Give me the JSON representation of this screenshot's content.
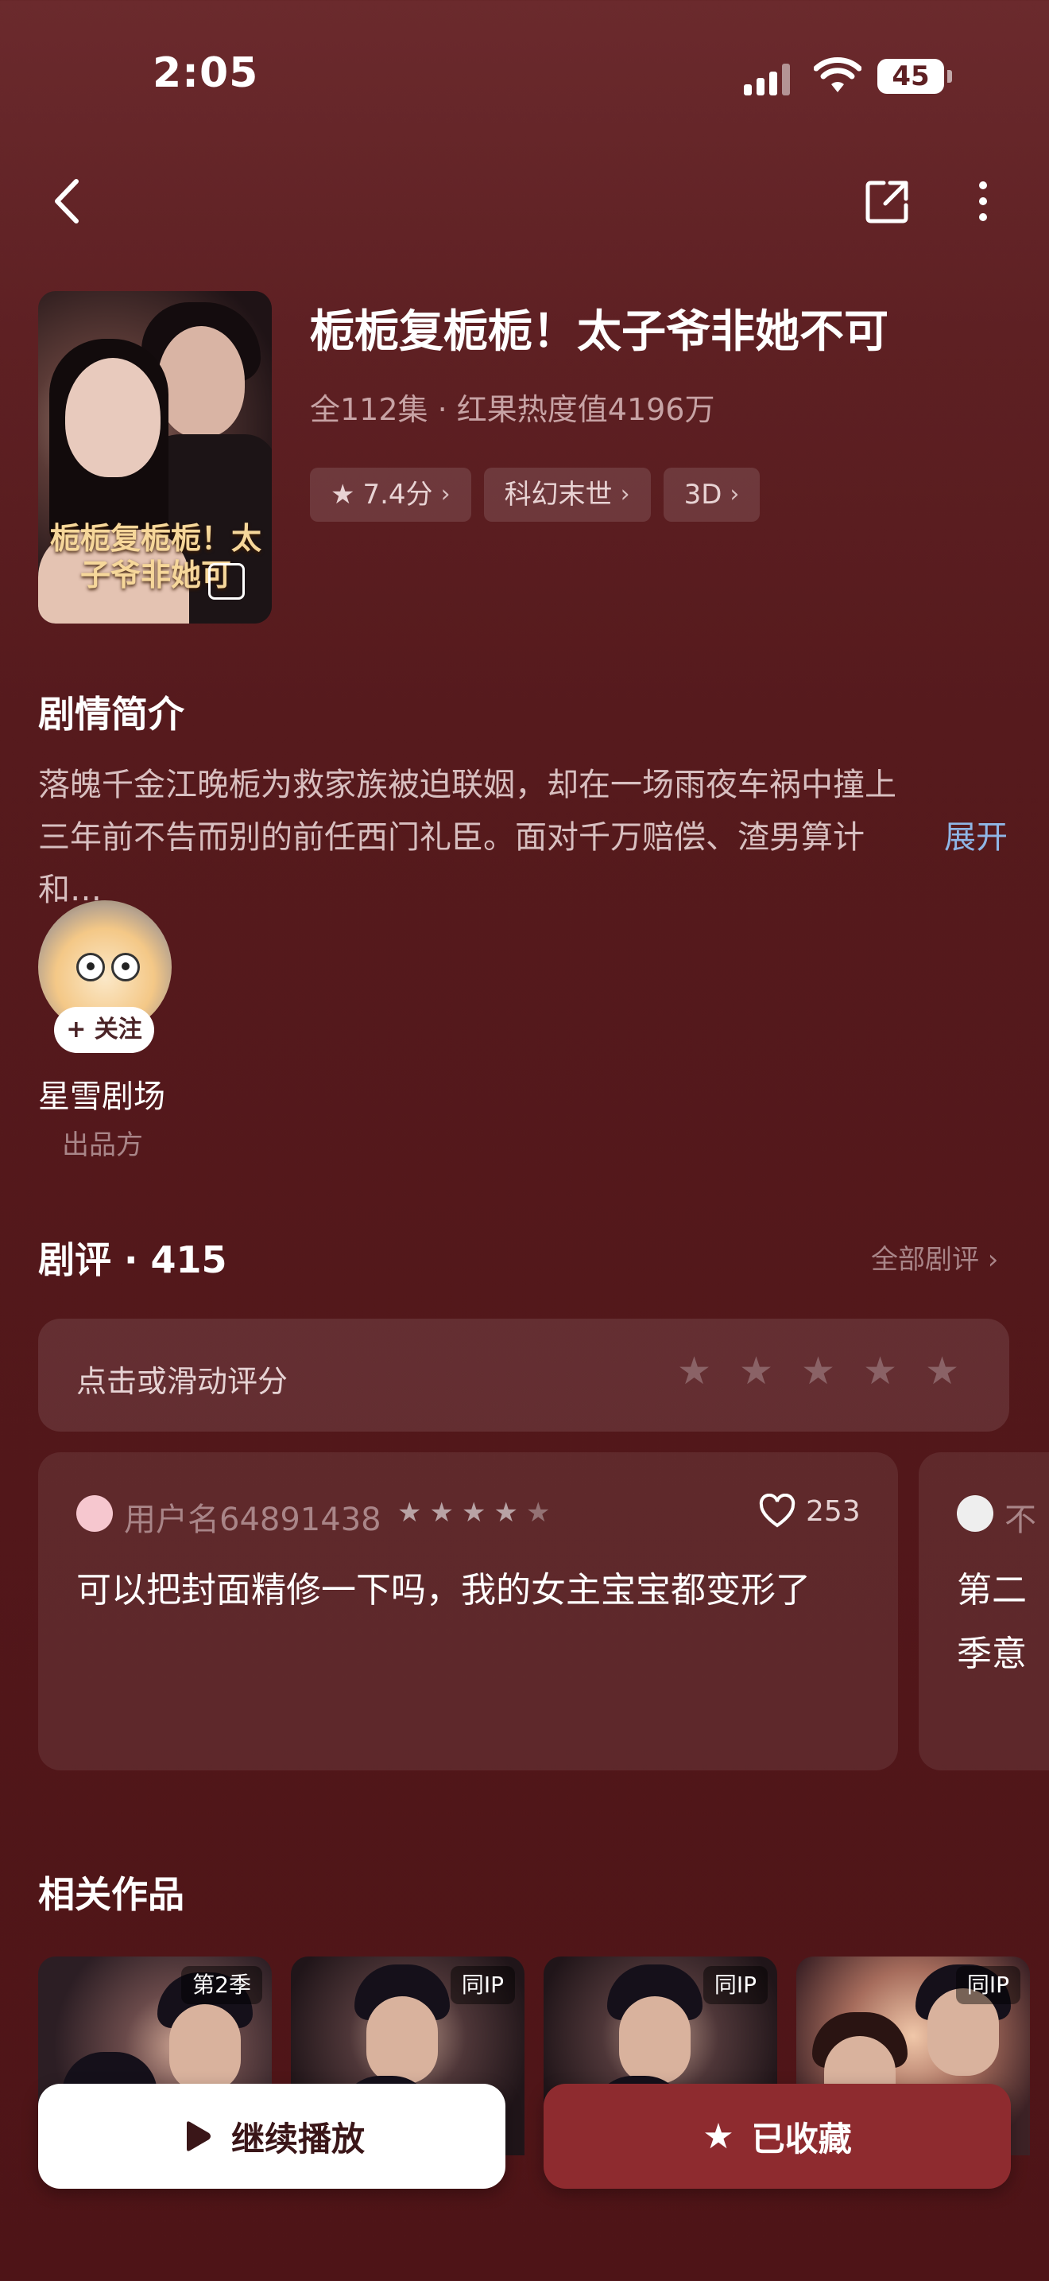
{
  "status": {
    "time": "2:05",
    "battery": "45"
  },
  "drama": {
    "title": "栀栀复栀栀！太子爷非她不可",
    "meta": "全112集 · 红果热度值4196万",
    "cover_title": "栀栀复栀栀！太子爷非她可",
    "tags": [
      {
        "label": "7.4分",
        "icon": "star-icon"
      },
      {
        "label": "科幻末世"
      },
      {
        "label": "3D"
      }
    ]
  },
  "synopsis": {
    "heading": "剧情简介",
    "text": "落魄千金江晚栀为救家族被迫联姻，却在一场雨夜车祸中撞上三年前不告而别的前任西门礼臣。面对千万赔偿、渣男算计和…",
    "expand": "展开"
  },
  "producer": {
    "follow": "+ 关注",
    "name": "星雪剧场",
    "role": "出品方"
  },
  "reviews": {
    "heading": "剧评 · 415",
    "all_link": "全部剧评 ›",
    "rate_prompt": "点击或滑动评分",
    "rate_stars": 5,
    "items": [
      {
        "user": "用户名64891438",
        "rating": 4.5,
        "likes": "253",
        "text": "可以把封面精修一下吗，我的女主宝宝都变形了"
      },
      {
        "user": "不",
        "text": "第二季意"
      }
    ]
  },
  "related": {
    "heading": "相关作品",
    "items": [
      {
        "badge": "第2季"
      },
      {
        "badge": "同IP"
      },
      {
        "badge": "同IP"
      },
      {
        "badge": "同IP"
      }
    ]
  },
  "actions": {
    "play": "继续播放",
    "favorite": "已收藏"
  },
  "colors": {
    "background": "#5e2023",
    "accent_button": "#8e2b2f",
    "link": "#8fb6e6"
  }
}
